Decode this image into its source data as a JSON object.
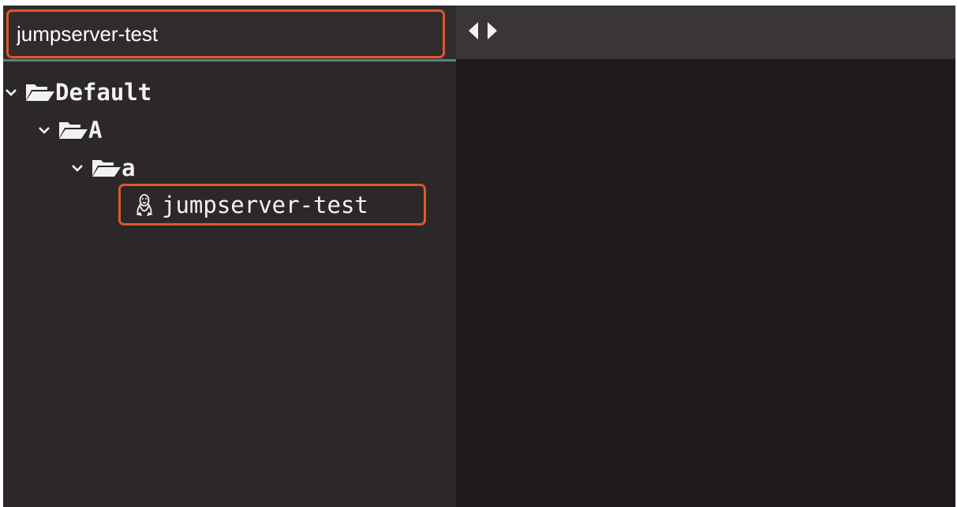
{
  "search": {
    "value": "jumpserver-test",
    "placeholder": ""
  },
  "tree": {
    "nodes": [
      {
        "label": "Default",
        "icon": "folder-open-icon",
        "expanded": true
      },
      {
        "label": "A",
        "icon": "folder-open-icon",
        "expanded": true
      },
      {
        "label": "a",
        "icon": "folder-open-icon",
        "expanded": true
      }
    ],
    "asset": {
      "label": "jumpserver-test",
      "icon": "linux-icon"
    }
  },
  "colors": {
    "highlight": "#e0562e",
    "accent": "#4d8a7c",
    "sidebar_bg": "#2c2828",
    "content_bg": "#1f1b1b",
    "tabbar_bg": "#3a3636"
  }
}
